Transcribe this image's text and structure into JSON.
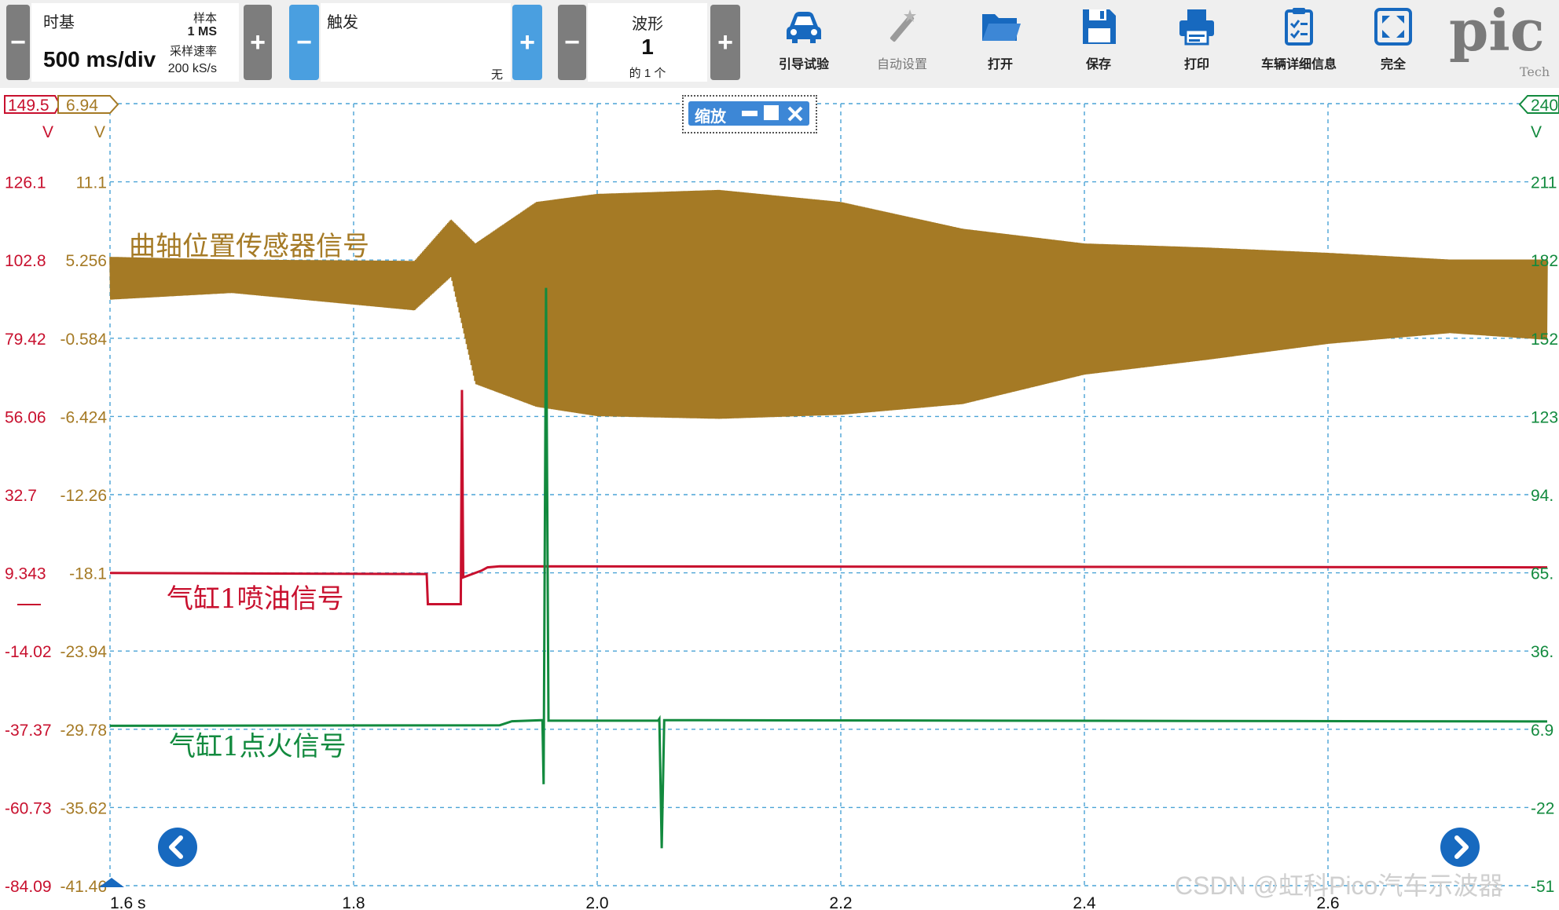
{
  "toolbar": {
    "timebase": {
      "title": "时基",
      "value": "500 ms/div",
      "samples_label": "样本",
      "samples_value": "1 MS",
      "rate_label": "采样速率",
      "rate_value": "200 kS/s",
      "minus": "−",
      "plus": "+"
    },
    "trigger": {
      "title": "触发",
      "mode": "无",
      "minus": "−",
      "plus": "+"
    },
    "waveform": {
      "title": "波形",
      "value": "1",
      "of_label": "的 1 个",
      "minus": "−",
      "plus": "+"
    },
    "tools": [
      {
        "label": "引导试验",
        "icon": "car-icon"
      },
      {
        "label": "自动设置",
        "icon": "magic-wand-icon"
      },
      {
        "label": "打开",
        "icon": "folder-icon"
      },
      {
        "label": "保存",
        "icon": "floppy-disk-icon"
      },
      {
        "label": "打印",
        "icon": "printer-icon"
      },
      {
        "label": "车辆详细信息",
        "icon": "clipboard-icon"
      },
      {
        "label": "完全",
        "icon": "fullscreen-icon"
      }
    ],
    "logo_text": "pic",
    "logo_sub": "Tech"
  },
  "zoom": {
    "label": "缩放"
  },
  "axes": {
    "red": {
      "color": "#c8102e",
      "unit": "V",
      "top_label": "149.5",
      "ticks": [
        "126.1",
        "102.8",
        "79.42",
        "56.06",
        "32.7",
        "9.343",
        "-14.02",
        "-37.37",
        "-60.73",
        "-84.09"
      ]
    },
    "yellow": {
      "color": "#a57a25",
      "unit": "V",
      "top_label": "6.94",
      "ticks": [
        "11.1",
        "5.256",
        "-0.584",
        "-6.424",
        "-12.26",
        "-18.1",
        "-23.94",
        "-29.78",
        "-35.62",
        "-41.46"
      ]
    },
    "green": {
      "color": "#128a3e",
      "unit": "V",
      "top_label": "240",
      "ticks": [
        "211",
        "182",
        "152",
        "123",
        "94.",
        "65.",
        "36.",
        "6.9",
        "-22",
        "-51"
      ]
    },
    "x": {
      "ticks": [
        "1.6 s",
        "1.8",
        "2.0",
        "2.2",
        "2.4",
        "2.6"
      ]
    }
  },
  "chart_data": {
    "type": "line",
    "xlabel": "",
    "x_unit": "s",
    "x_range": [
      1.6,
      2.78
    ],
    "series": [
      {
        "name": "曲轴位置传感器信号",
        "color": "#a57a25",
        "x": [
          1.6,
          1.7,
          1.85,
          1.88,
          1.9,
          1.95,
          2.0,
          2.1,
          2.2,
          2.3,
          2.4,
          2.5,
          2.6,
          2.7,
          2.78
        ],
        "y": [
          2.3,
          2.8,
          1.5,
          4.0,
          -4.0,
          -5.7,
          -6.4,
          -6.6,
          -6.3,
          -5.5,
          -3.3,
          -2.2,
          -1.0,
          -0.2,
          -0.7
        ],
        "envelope_max": [
          5.5,
          5.3,
          5.2,
          8.3,
          6.5,
          9.6,
          10.2,
          10.5,
          9.6,
          7.6,
          6.5,
          6.2,
          5.8,
          5.3,
          5.3
        ]
      },
      {
        "name": "气缸1喷油信号",
        "color": "#c8102e",
        "x": [
          1.6,
          1.86,
          1.861,
          1.888,
          1.889,
          1.89,
          1.905,
          1.91,
          1.92,
          2.78
        ],
        "y": [
          9.3,
          9.0,
          0.0,
          0.0,
          64.0,
          8.0,
          10.0,
          11.0,
          11.3,
          11.0
        ]
      },
      {
        "name": "气缸1点火信号",
        "color": "#128a3e",
        "x": [
          1.6,
          1.92,
          1.93,
          1.955,
          1.956,
          1.958,
          1.96,
          2.05,
          2.051,
          2.053,
          2.055,
          2.78
        ],
        "y": [
          6.9,
          7.1,
          8.6,
          9.0,
          -15.0,
          171.0,
          8.8,
          8.8,
          9.5,
          -39.0,
          9.0,
          8.5
        ]
      }
    ]
  },
  "watermark": "CSDN @虹科Pico汽车示波器"
}
